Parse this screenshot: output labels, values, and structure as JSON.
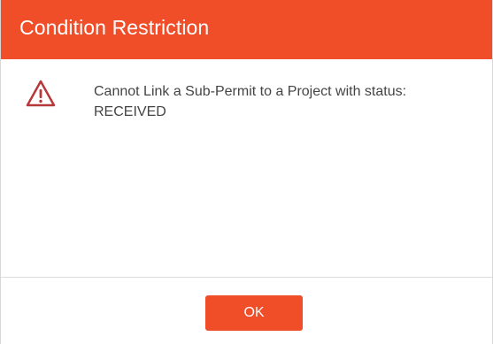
{
  "dialog": {
    "title": "Condition Restriction",
    "icon": "warning-triangle-icon",
    "message": "Cannot Link a Sub-Permit to a Project with status: RECEIVED",
    "ok_label": "OK"
  },
  "colors": {
    "accent": "#f04d29",
    "icon": "#b6383b",
    "text": "#444444"
  }
}
